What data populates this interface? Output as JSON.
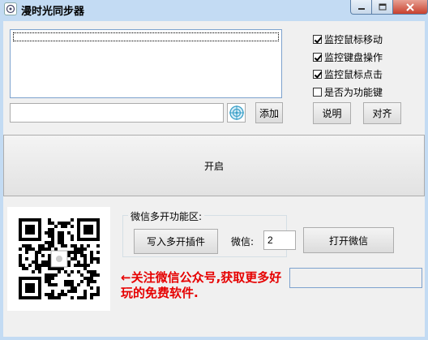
{
  "window": {
    "title": "漫时光同步器"
  },
  "checkboxes": [
    {
      "label": "监控鼠标移动",
      "checked": true
    },
    {
      "label": "监控键盘操作",
      "checked": true
    },
    {
      "label": "监控鼠标点击",
      "checked": true
    },
    {
      "label": "是否为功能键",
      "checked": false
    }
  ],
  "input": {
    "value": ""
  },
  "buttons": {
    "add": "添加",
    "help": "说明",
    "align": "对齐",
    "start": "开启",
    "write_plugin": "写入多开插件",
    "open_wechat": "打开微信"
  },
  "wechat_group": {
    "title": "微信多开功能区:",
    "count_label": "微信:",
    "count_value": "2"
  },
  "promo": {
    "text": "←关注微信公众号,获取更多好玩的免费软件."
  },
  "icons": [
    "app-icon",
    "minimize-icon",
    "maximize-icon",
    "close-icon",
    "crosshair-target-icon",
    "qr-code"
  ],
  "colors": {
    "title_bar": "#c3dbf3",
    "close_button": "#c7402d",
    "promo_text": "#e60000"
  }
}
